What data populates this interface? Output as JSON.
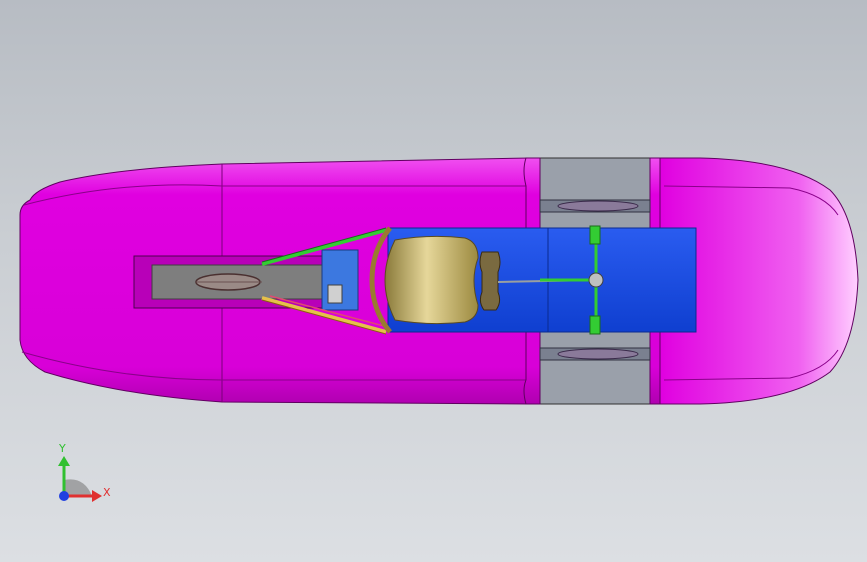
{
  "viewport": {
    "background_top": "#b7bcc3",
    "background_bottom": "#dcdfe3"
  },
  "model": {
    "body_color": "#e600e6",
    "body_highlight": "#ff8cff",
    "deck_color": "#1a4fe0",
    "seat_color": "#c8b46a",
    "frame_color": "#2a2a2a",
    "strut_green": "#33cc33",
    "strut_yellow": "#e6c04a"
  },
  "triad": {
    "x_label": "X",
    "y_label": "Y",
    "x_color": "#e03030",
    "y_color": "#30c030",
    "z_color": "#2040e0"
  }
}
